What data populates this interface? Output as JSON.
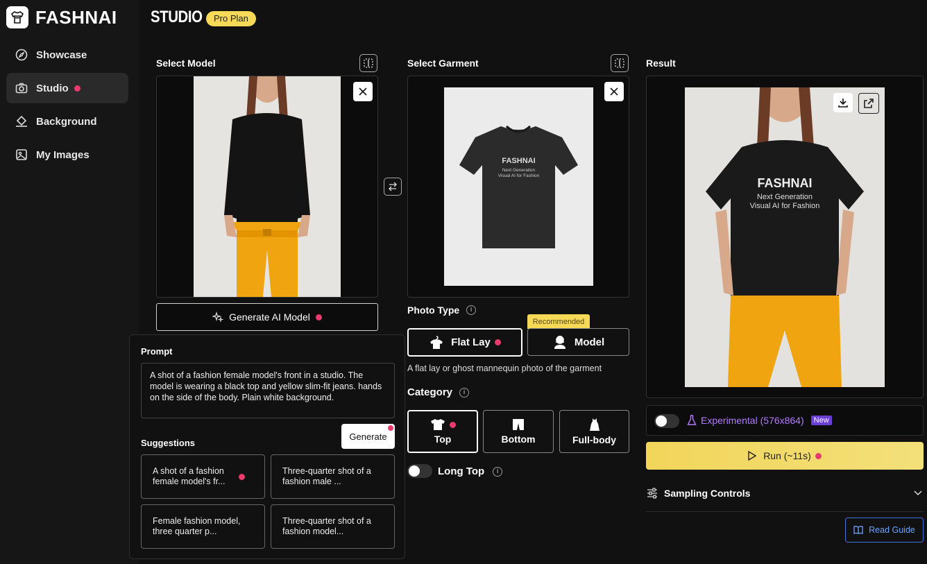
{
  "brand": {
    "name": "FASHNAI",
    "section": "STUDIO",
    "plan": "Pro Plan"
  },
  "sidebar": {
    "items": [
      {
        "label": "Showcase",
        "icon": "compass-icon"
      },
      {
        "label": "Studio",
        "icon": "camera-icon",
        "active": true
      },
      {
        "label": "Background",
        "icon": "paint-bucket-icon"
      },
      {
        "label": "My Images",
        "icon": "image-icon"
      }
    ]
  },
  "model": {
    "title": "Select Model",
    "generate_label": "Generate AI Model"
  },
  "garment": {
    "title": "Select Garment",
    "shirt_brand": "FASHNAI",
    "shirt_line1": "Next Generation",
    "shirt_line2": "Visual AI for Fashion",
    "photo_type_label": "Photo Type",
    "recommended": "Recommended",
    "flat_lay": "Flat Lay",
    "model_option": "Model",
    "hint": "A flat lay or ghost mannequin photo of the garment",
    "category_label": "Category",
    "categories": [
      "Top",
      "Bottom",
      "Full-body"
    ],
    "long_top": "Long Top"
  },
  "prompt": {
    "label": "Prompt",
    "text": "A shot of a fashion female model's front in a studio. The model is wearing a black top and yellow slim-fit jeans. hands on the side of the body. Plain white background.",
    "generate": "Generate",
    "suggestions_label": "Suggestions",
    "suggestions": [
      "A shot of a fashion female model's fr...",
      "Three-quarter shot of a fashion male ...",
      "Female fashion model, three quarter p...",
      "Three-quarter shot of a fashion model..."
    ]
  },
  "result": {
    "title": "Result",
    "shirt_brand": "FASHNAI",
    "shirt_line1": "Next Generation",
    "shirt_line2": "Visual AI for Fashion",
    "experimental": "Experimental (576x864)",
    "new_badge": "New",
    "run": "Run (~11s)",
    "sampling": "Sampling Controls",
    "read_guide": "Read Guide"
  },
  "colors": {
    "accent_pink": "#e93a6d",
    "run_yellow": "#f2d55a",
    "experimental_purple": "#b57bff",
    "guide_blue": "#3a77d8"
  }
}
